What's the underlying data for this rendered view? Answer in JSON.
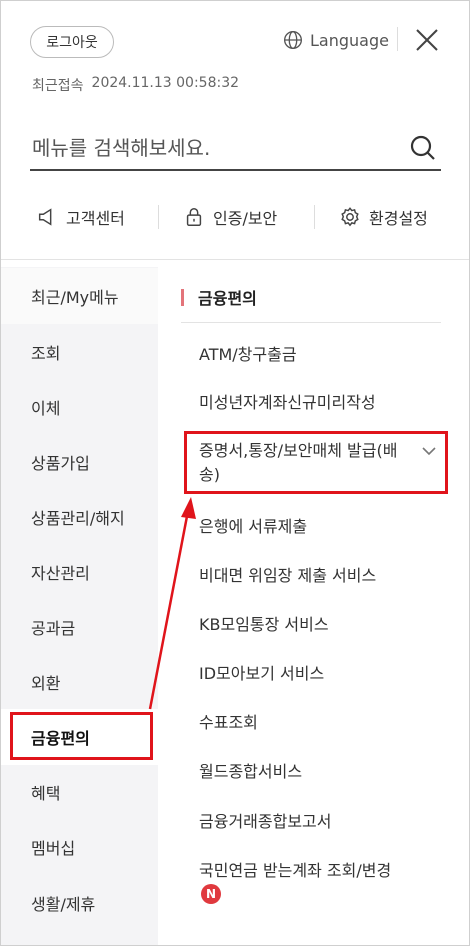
{
  "header": {
    "logout_label": "로그아웃",
    "language_label": "Language",
    "last_login_label": "최근접속",
    "last_login_time": "2024.11.13 00:58:32"
  },
  "search": {
    "placeholder": "메뉴를 검색해보세요."
  },
  "quick_links": [
    {
      "label": "고객센터",
      "icon": "megaphone-icon"
    },
    {
      "label": "인증/보안",
      "icon": "lock-icon"
    },
    {
      "label": "환경설정",
      "icon": "gear-icon"
    }
  ],
  "categories": [
    {
      "label": "최근/My메뉴"
    },
    {
      "label": "조회"
    },
    {
      "label": "이체"
    },
    {
      "label": "상품가입"
    },
    {
      "label": "상품관리/해지"
    },
    {
      "label": "자산관리"
    },
    {
      "label": "공과금"
    },
    {
      "label": "외환"
    },
    {
      "label": "금융편의",
      "active": true
    },
    {
      "label": "혜택"
    },
    {
      "label": "멤버십"
    },
    {
      "label": "생활/제휴"
    }
  ],
  "menu": {
    "title": "금융편의",
    "items": [
      {
        "label": "ATM/창구출금"
      },
      {
        "label": "미성년자계좌신규미리작성"
      },
      {
        "label": "증명서,통장/보안매체 발급(배송)",
        "expandable": true
      },
      {
        "label": "은행에 서류제출"
      },
      {
        "label": "비대면 위임장 제출 서비스"
      },
      {
        "label": "KB모임통장 서비스"
      },
      {
        "label": "ID모아보기 서비스"
      },
      {
        "label": "수표조회"
      },
      {
        "label": "월드종합서비스"
      },
      {
        "label": "금융거래종합보고서"
      },
      {
        "label": "국민연금 받는계좌 조회/변경",
        "badge": "N"
      }
    ]
  },
  "colors": {
    "accent_bar": "#e3747a",
    "annotation_red": "#e0141b",
    "badge_red": "#e0393e",
    "category_bg": "#f4f4f6"
  }
}
